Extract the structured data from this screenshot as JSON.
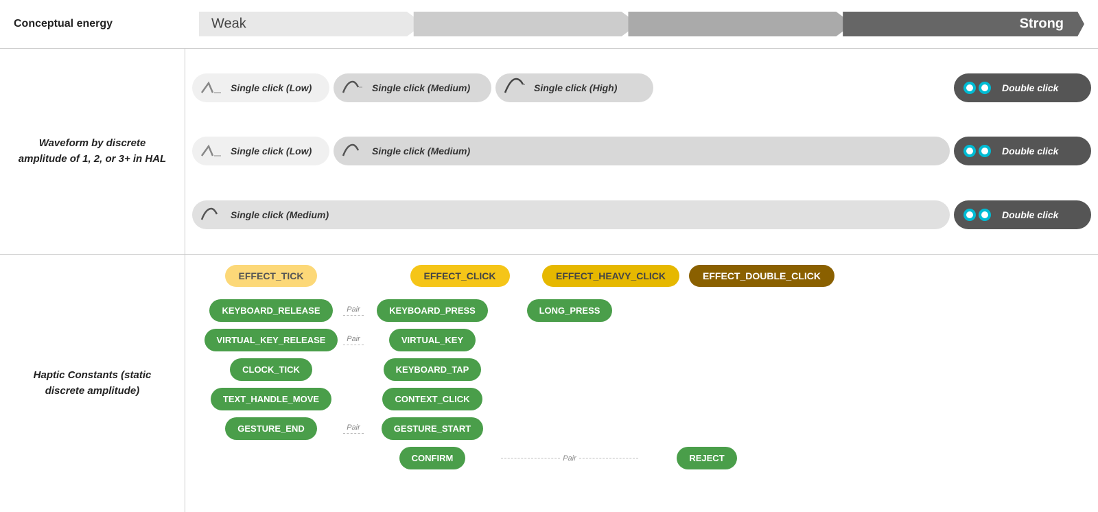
{
  "labels": {
    "conceptual_energy": "Conceptual energy",
    "weak": "Weak",
    "strong": "Strong",
    "waveform_label": "Waveform by discrete amplitude of 1, 2, or 3+ in HAL",
    "haptic_label": "Haptic Constants (static discrete amplitude)"
  },
  "waveform_rows": [
    {
      "items": [
        {
          "type": "wave_low",
          "label": "Single click (Low)",
          "style": "light"
        },
        {
          "type": "wave_medium",
          "label": "Single click (Medium)",
          "style": "medium"
        },
        {
          "type": "wave_high",
          "label": "Single click (High)",
          "style": "medium"
        },
        {
          "type": "double",
          "label": "Double click",
          "style": "dark"
        }
      ]
    },
    {
      "items": [
        {
          "type": "wave_low",
          "label": "Single click (Low)",
          "style": "light"
        },
        {
          "type": "wave_medium",
          "label": "Single click (Medium)",
          "style": "medium"
        },
        {
          "type": "double",
          "label": "Double click",
          "style": "dark"
        }
      ]
    },
    {
      "items": [
        {
          "type": "wave_medium",
          "label": "Single click (Medium)",
          "style": "medium"
        },
        {
          "type": "double",
          "label": "Double click",
          "style": "dark"
        }
      ]
    }
  ],
  "effects": [
    {
      "label": "EFFECT_TICK",
      "style": "light_yellow"
    },
    {
      "label": "EFFECT_CLICK",
      "style": "yellow"
    },
    {
      "label": "EFFECT_HEAVY_CLICK",
      "style": "yellow"
    },
    {
      "label": "EFFECT_DOUBLE_CLICK",
      "style": "dark_gold"
    }
  ],
  "haptic_constants": {
    "col1": [
      {
        "label": "KEYBOARD_RELEASE",
        "pair": true
      },
      {
        "label": "VIRTUAL_KEY_RELEASE",
        "pair": true
      },
      {
        "label": "CLOCK_TICK",
        "pair": false
      },
      {
        "label": "TEXT_HANDLE_MOVE",
        "pair": false
      },
      {
        "label": "GESTURE_END",
        "pair": true
      }
    ],
    "col2": [
      {
        "label": "KEYBOARD_PRESS"
      },
      {
        "label": "VIRTUAL_KEY"
      },
      {
        "label": "KEYBOARD_TAP"
      },
      {
        "label": "CONTEXT_CLICK"
      },
      {
        "label": "GESTURE_START"
      },
      {
        "label": "CONFIRM"
      }
    ],
    "col3": [
      {
        "label": "LONG_PRESS"
      }
    ],
    "col4": [
      {
        "label": "REJECT"
      }
    ]
  },
  "pair_label": "Pair"
}
